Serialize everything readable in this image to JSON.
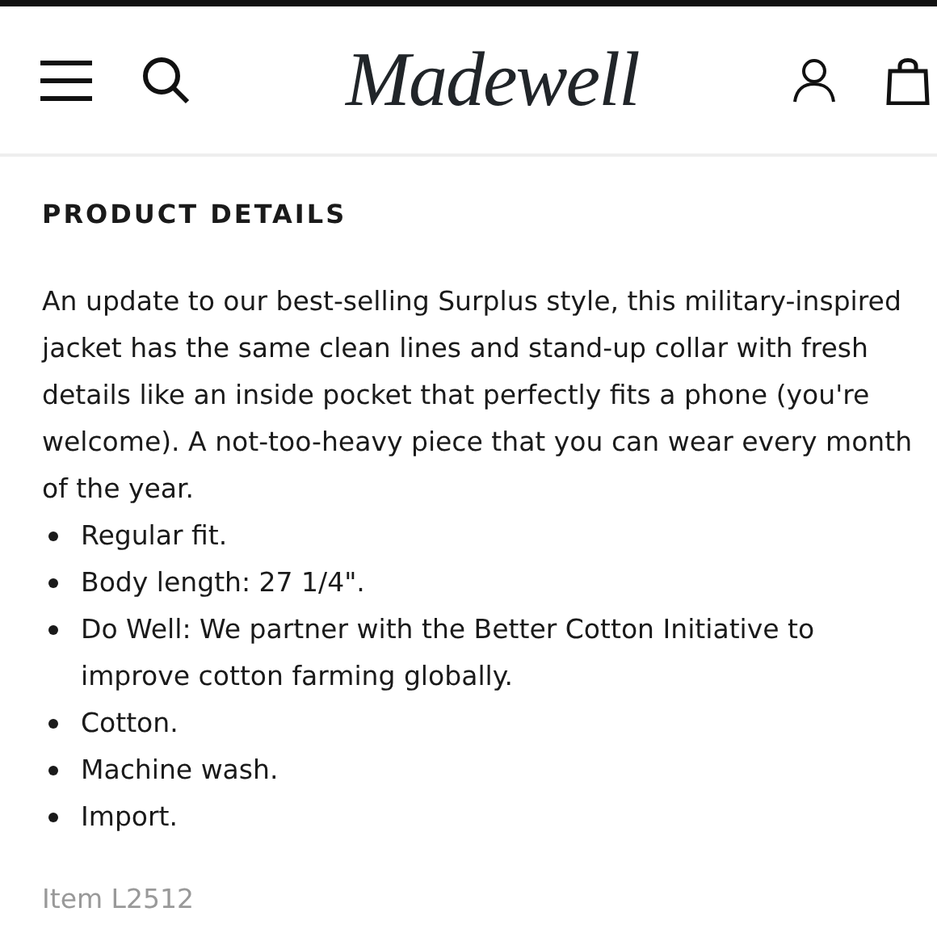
{
  "header": {
    "logo": "Madewell"
  },
  "section": {
    "title": "PRODUCT DETAILS",
    "description": "An update to our best-selling Surplus style, this military-inspired jacket has the same clean lines and stand-up collar with fresh details like an inside pocket that perfectly fits a phone (you're welcome). A not-too-heavy piece that you can wear every month of the year.",
    "bullets": [
      "Regular fit.",
      "Body length: 27 1/4\".",
      "Do Well: We partner with the Better Cotton Initiative to improve cotton farming globally.",
      "Cotton.",
      "Machine wash.",
      "Import."
    ],
    "item_number": "Item L2512"
  }
}
